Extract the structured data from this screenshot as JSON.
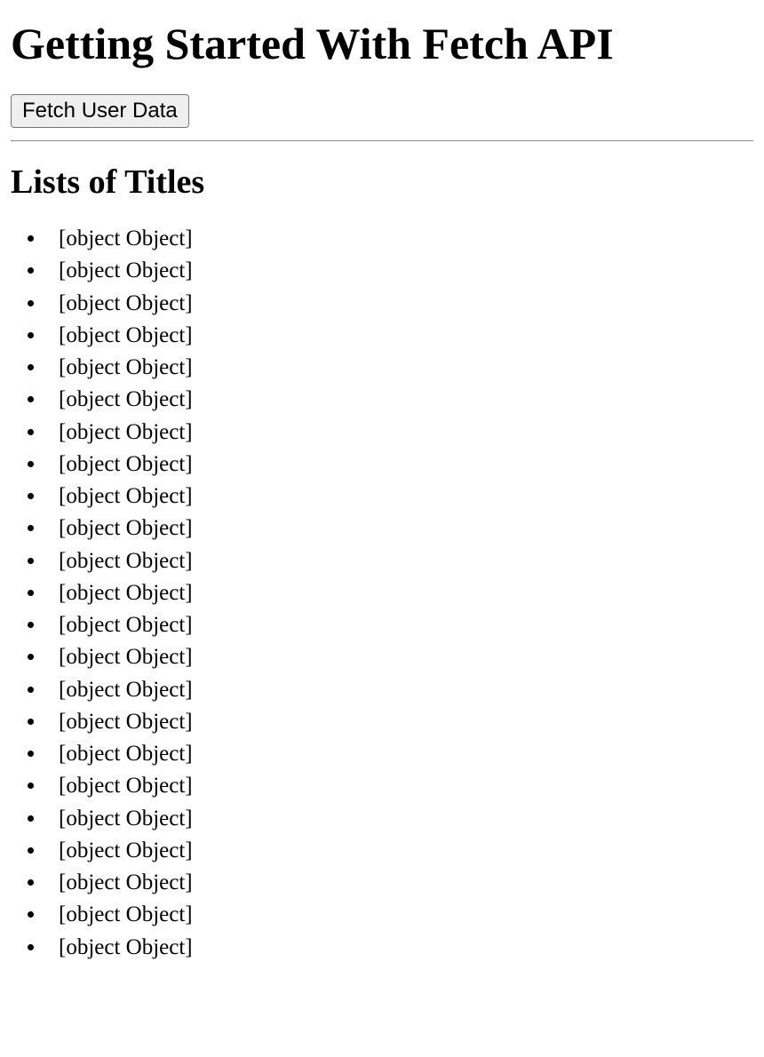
{
  "heading": "Getting Started With Fetch API",
  "button_label": "Fetch User Data",
  "subheading": "Lists of Titles",
  "list_items": [
    "[object Object]",
    "[object Object]",
    "[object Object]",
    "[object Object]",
    "[object Object]",
    "[object Object]",
    "[object Object]",
    "[object Object]",
    "[object Object]",
    "[object Object]",
    "[object Object]",
    "[object Object]",
    "[object Object]",
    "[object Object]",
    "[object Object]",
    "[object Object]",
    "[object Object]",
    "[object Object]",
    "[object Object]",
    "[object Object]",
    "[object Object]",
    "[object Object]",
    "[object Object]"
  ]
}
